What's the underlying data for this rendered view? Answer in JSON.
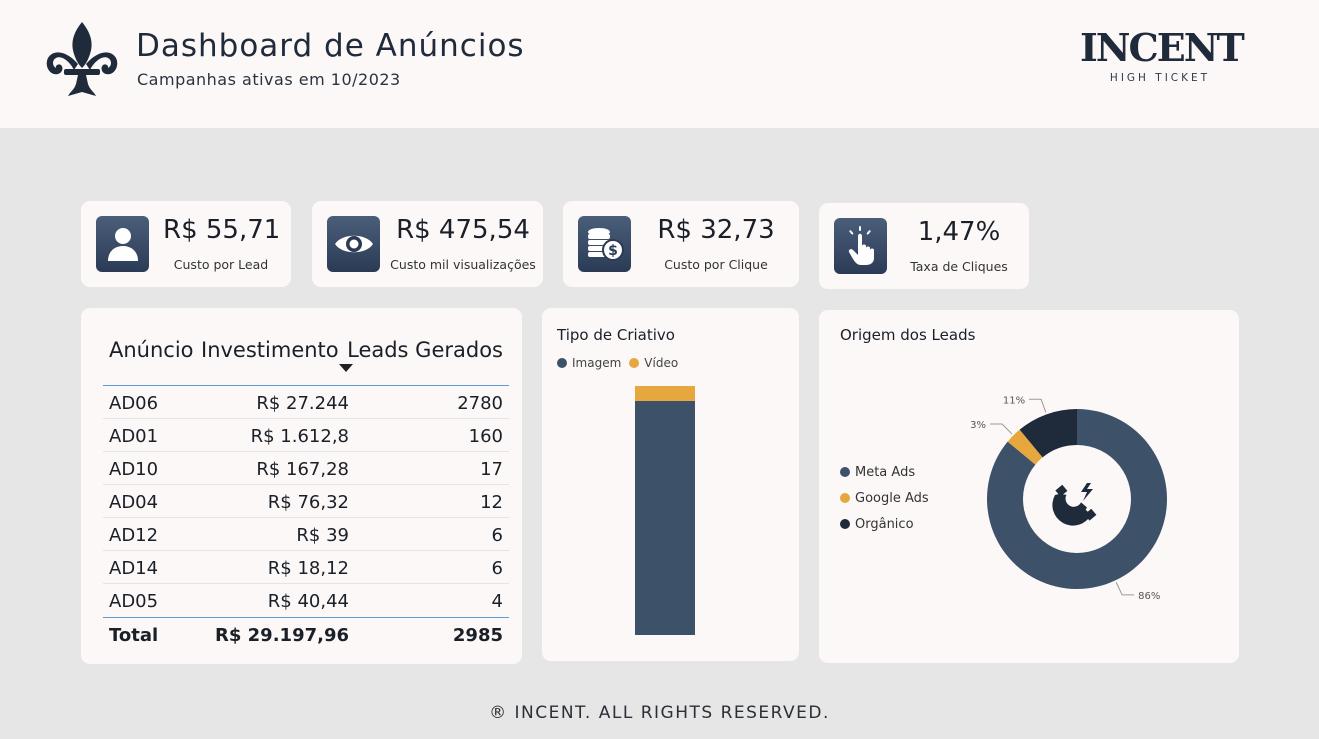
{
  "header": {
    "title": "Dashboard de Anúncios",
    "subtitle": "Campanhas ativas em 10/2023",
    "brand_name": "INCENT",
    "brand_tagline": "HIGH TICKET"
  },
  "kpis": [
    {
      "value": "R$ 55,71",
      "label": "Custo por Lead",
      "icon": "user-icon"
    },
    {
      "value": "R$ 475,54",
      "label": "Custo mil visualizações",
      "icon": "eye-icon"
    },
    {
      "value": "R$ 32,73",
      "label": "Custo por Clique",
      "icon": "coins-icon"
    },
    {
      "value": "1,47%",
      "label": "Taxa de Cliques",
      "icon": "tap-icon"
    }
  ],
  "ads_table": {
    "columns": [
      "Anúncio",
      "Investimento",
      "Leads Gerados"
    ],
    "rows": [
      [
        "AD06",
        "R$ 27.244",
        "2780"
      ],
      [
        "AD01",
        "R$ 1.612,8",
        "160"
      ],
      [
        "AD10",
        "R$ 167,28",
        "17"
      ],
      [
        "AD04",
        "R$ 76,32",
        "12"
      ],
      [
        "AD12",
        "R$ 39",
        "6"
      ],
      [
        "AD14",
        "R$ 18,12",
        "6"
      ],
      [
        "AD05",
        "R$ 40,44",
        "4"
      ]
    ],
    "total": [
      "Total",
      "R$ 29.197,96",
      "2985"
    ]
  },
  "creative_panel": {
    "title": "Tipo de Criativo",
    "legend": [
      "Imagem",
      "Vídeo"
    ]
  },
  "origin_panel": {
    "title": "Origem dos Leads",
    "legend": [
      "Meta Ads",
      "Google Ads",
      "Orgânico"
    ]
  },
  "chart_data": [
    {
      "type": "bar",
      "stacked": true,
      "categories": [
        ""
      ],
      "series": [
        {
          "name": "Imagem",
          "values": [
            94
          ],
          "color": "#3d5169"
        },
        {
          "name": "Vídeo",
          "values": [
            6
          ],
          "color": "#e5a73e"
        }
      ],
      "ylim": [
        0,
        100
      ]
    },
    {
      "type": "pie",
      "donut": true,
      "labels": [
        "Meta Ads",
        "Google Ads",
        "Orgânico"
      ],
      "values": [
        86,
        3,
        11
      ],
      "value_labels": [
        "86%",
        "3%",
        "11%"
      ],
      "colors": [
        "#3d5169",
        "#e5a73e",
        "#1f2a3a"
      ]
    }
  ],
  "footer": "® INCENT. ALL RIGHTS RESERVED."
}
